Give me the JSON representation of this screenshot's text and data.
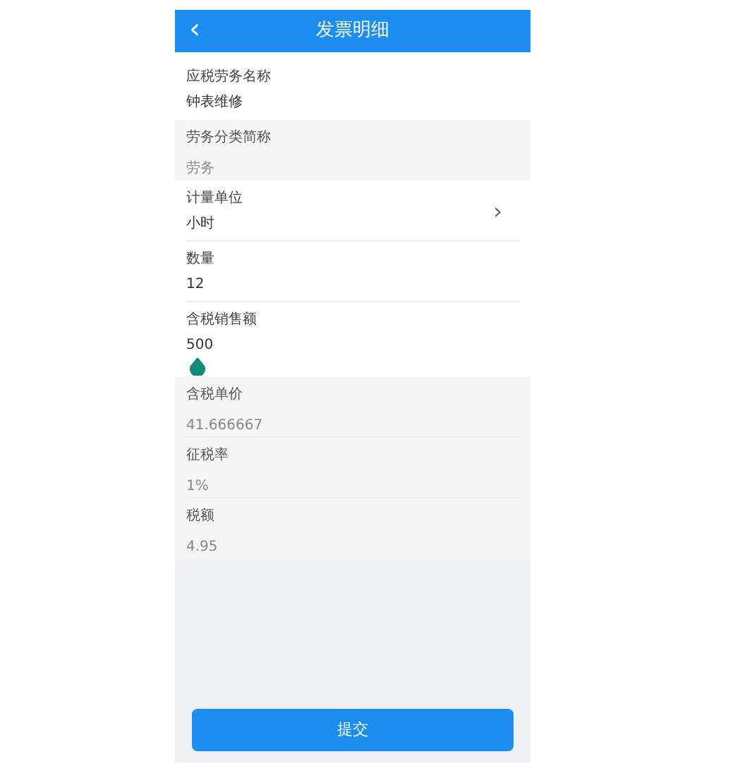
{
  "header": {
    "back": "‹",
    "title": "发票明细"
  },
  "sections": [
    {
      "readonly": false,
      "fields": [
        {
          "kind": "text",
          "label": "应税劳务名称",
          "value": "钟表维修",
          "focused": false
        }
      ]
    },
    {
      "readonly": true,
      "fields": [
        {
          "kind": "text",
          "label": "劳务分类简称",
          "value": "劳务",
          "focused": false
        }
      ]
    },
    {
      "readonly": false,
      "fields": [
        {
          "kind": "select",
          "label": "计量单位",
          "value": "小时",
          "chevron": "›",
          "focused": false
        },
        {
          "kind": "text",
          "label": "数量",
          "value": "12",
          "focused": false
        },
        {
          "kind": "text",
          "label": "含税销售额",
          "value": "500",
          "focused": true
        }
      ]
    },
    {
      "readonly": true,
      "fields": [
        {
          "kind": "text",
          "label": "含税单价",
          "value": "41.666667",
          "focused": false
        },
        {
          "kind": "text",
          "label": "征税率",
          "value": "1%",
          "focused": false
        },
        {
          "kind": "text",
          "label": "税额",
          "value": "4.95",
          "focused": false
        }
      ]
    }
  ],
  "submit": "提交"
}
